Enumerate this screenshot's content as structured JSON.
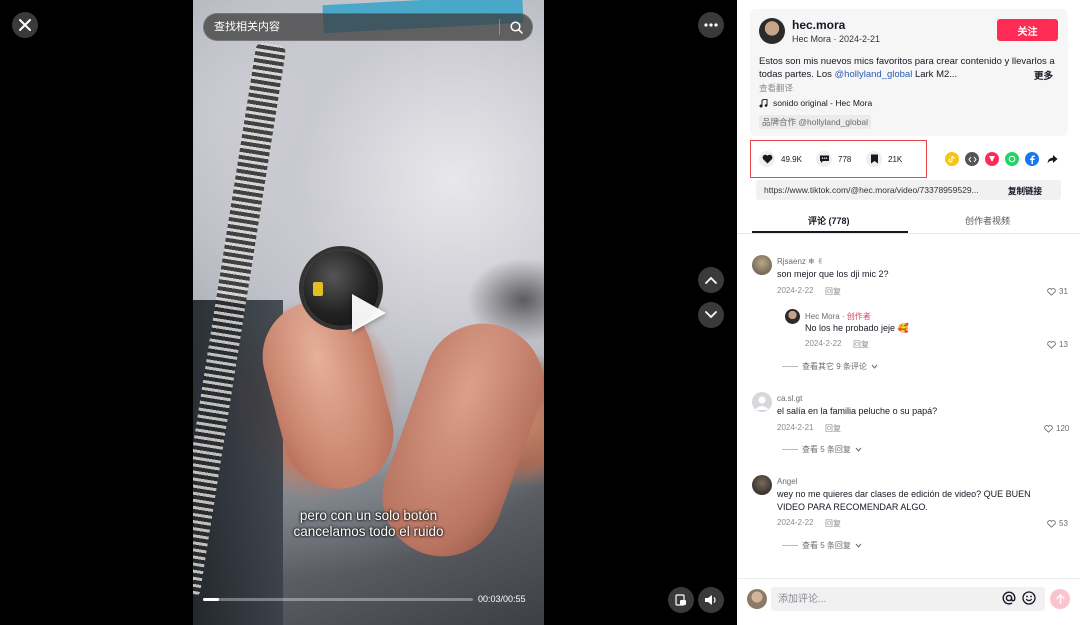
{
  "player": {
    "search_placeholder": "查找相关内容",
    "subtitle_line1": "pero con un solo botón",
    "subtitle_line2": "cancelamos todo el ruido",
    "timecode": "00:03/00:55",
    "progress": 0.06,
    "icons": [
      "close-icon",
      "search-icon",
      "more-icon",
      "chevron-up-icon",
      "chevron-down-icon",
      "play-icon",
      "picture-in-picture-icon",
      "volume-icon"
    ]
  },
  "author": {
    "handle": "hec.mora",
    "meta": "Hec Mora · 2024-2-21",
    "follow_label": "关注",
    "follow_color": "#fe2c55"
  },
  "post": {
    "desc_part1": "Estos son mis nuevos mics favoritos para crear contenido y llevarlos a todas partes. Los ",
    "desc_mention": "@hollyland_global",
    "desc_part2": " Lark M2...",
    "more_label": "更多",
    "translate_label": "查看翻译",
    "sound": "sonido original - Hec Mora",
    "brand_tag": "品牌合作 @hollyland_global"
  },
  "stats": {
    "likes": "49.9K",
    "comments": "778",
    "saves": "21K"
  },
  "share_icons": [
    "tiktok-share-icon",
    "embed-icon",
    "send-icon",
    "whatsapp-icon",
    "facebook-icon",
    "share-arrow-icon"
  ],
  "link": {
    "url": "https://www.tiktok.com/@hec.mora/video/73378959529...",
    "copy_label": "复制链接"
  },
  "tabs": {
    "comments": "评论 (778)",
    "creator_videos": "创作者视频"
  },
  "comments": [
    {
      "user": "Rjsaenz ❄ ✌",
      "text": "son mejor que los dji mic 2?",
      "date": "2024-2-22",
      "reply_label": "回复",
      "likes": "31"
    },
    {
      "user": "Hec Mora",
      "creator_tag": "· 创作者",
      "text": "No los he probado jeje 🥰",
      "date": "2024-2-22",
      "reply_label": "回复",
      "likes": "13"
    },
    {
      "user": "ca.sl.gt",
      "text": "el salía en la familia peluche o su papá?",
      "date": "2024-2-21",
      "reply_label": "回复",
      "likes": "120"
    },
    {
      "user": "Angel",
      "text": "wey no me quieres dar clases de edición de video? QUE BUEN VIDEO PARA RECOMENDAR ALGO.",
      "date": "2024-2-22",
      "reply_label": "回复",
      "likes": "53"
    }
  ],
  "more_replies": {
    "first": "查看其它 9 条评论",
    "second": "查看 5 条回复",
    "third": "查看 5 条回复"
  },
  "comment_input": {
    "placeholder": "添加评论..."
  }
}
